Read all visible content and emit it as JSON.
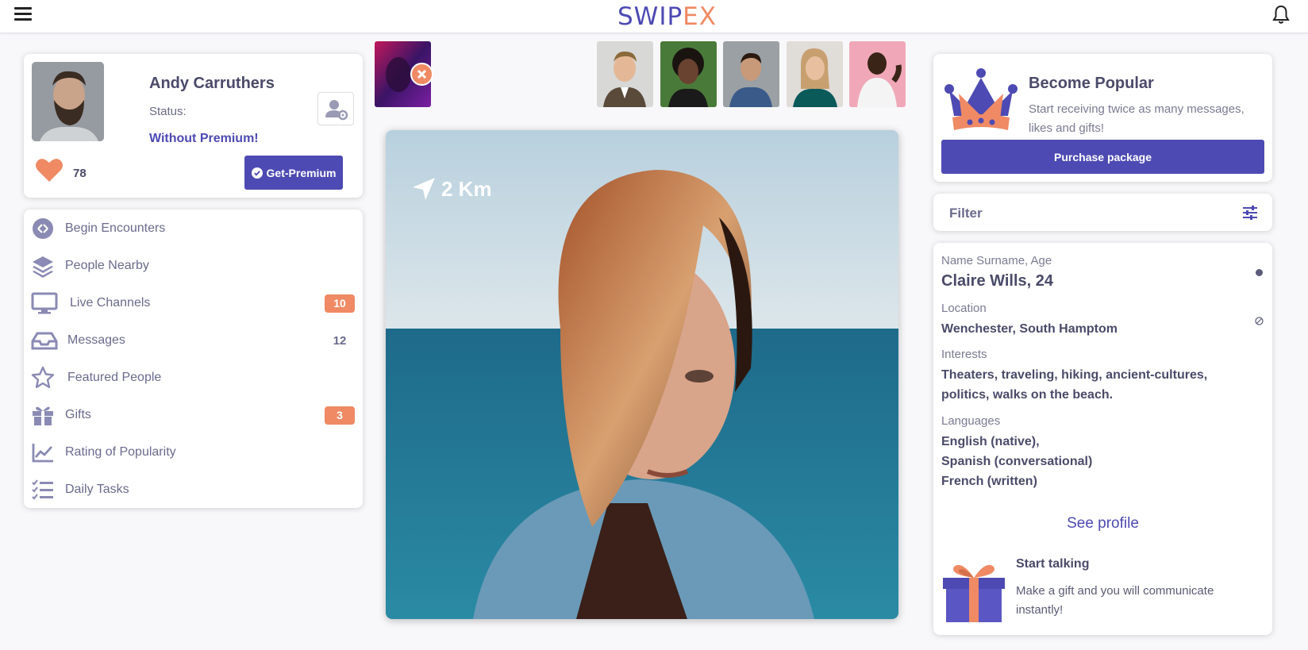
{
  "header": {
    "logo_part1": "SWIP",
    "logo_part2": "EX"
  },
  "profile": {
    "name": "Andy Carruthers",
    "status_label": "Status:",
    "status_value": "Without Premium!",
    "likes": "78",
    "premium_button": "Get-Premium"
  },
  "menu": {
    "items": [
      {
        "label": "Begin Encounters",
        "icon": "encounters-icon"
      },
      {
        "label": "People Nearby",
        "icon": "layers-icon"
      },
      {
        "label": "Live Channels",
        "icon": "monitor-icon",
        "badge": "10"
      },
      {
        "label": "Messages",
        "icon": "inbox-icon",
        "badge": "12"
      },
      {
        "label": "Featured People",
        "icon": "star-icon"
      },
      {
        "label": "Gifts",
        "icon": "gift-icon",
        "badge": "3"
      },
      {
        "label": "Rating of Popularity",
        "icon": "chart-line-icon"
      },
      {
        "label": "Daily Tasks",
        "icon": "tasks-icon"
      }
    ]
  },
  "photo": {
    "distance": "2 Km"
  },
  "popular": {
    "title": "Become Popular",
    "text": "Start receiving twice as many messages, likes and gifts!",
    "button": "Purchase package"
  },
  "filter": {
    "label": "Filter"
  },
  "details": {
    "name_label": "Name Surname, Age",
    "name_value": "Claire Wills, 24",
    "location_label": "Location",
    "location_value": "Wenchester, South Hamptom",
    "interests_label": "Interests",
    "interests_line1": "Theaters, traveling, hiking, ancient-cultures,",
    "interests_line2": "politics, walks on the beach.",
    "languages_label": "Languages",
    "lang1": "English (native),",
    "lang2": "Spanish (conversational)",
    "lang3": "French (written)",
    "see_profile": "See profile",
    "talk_title": "Start talking",
    "talk_text": "Make a gift and you will communicate instantly!"
  },
  "colors": {
    "accent": "#4d4ab3",
    "orange": "#ef8a64",
    "text": "#4a4a6a"
  }
}
